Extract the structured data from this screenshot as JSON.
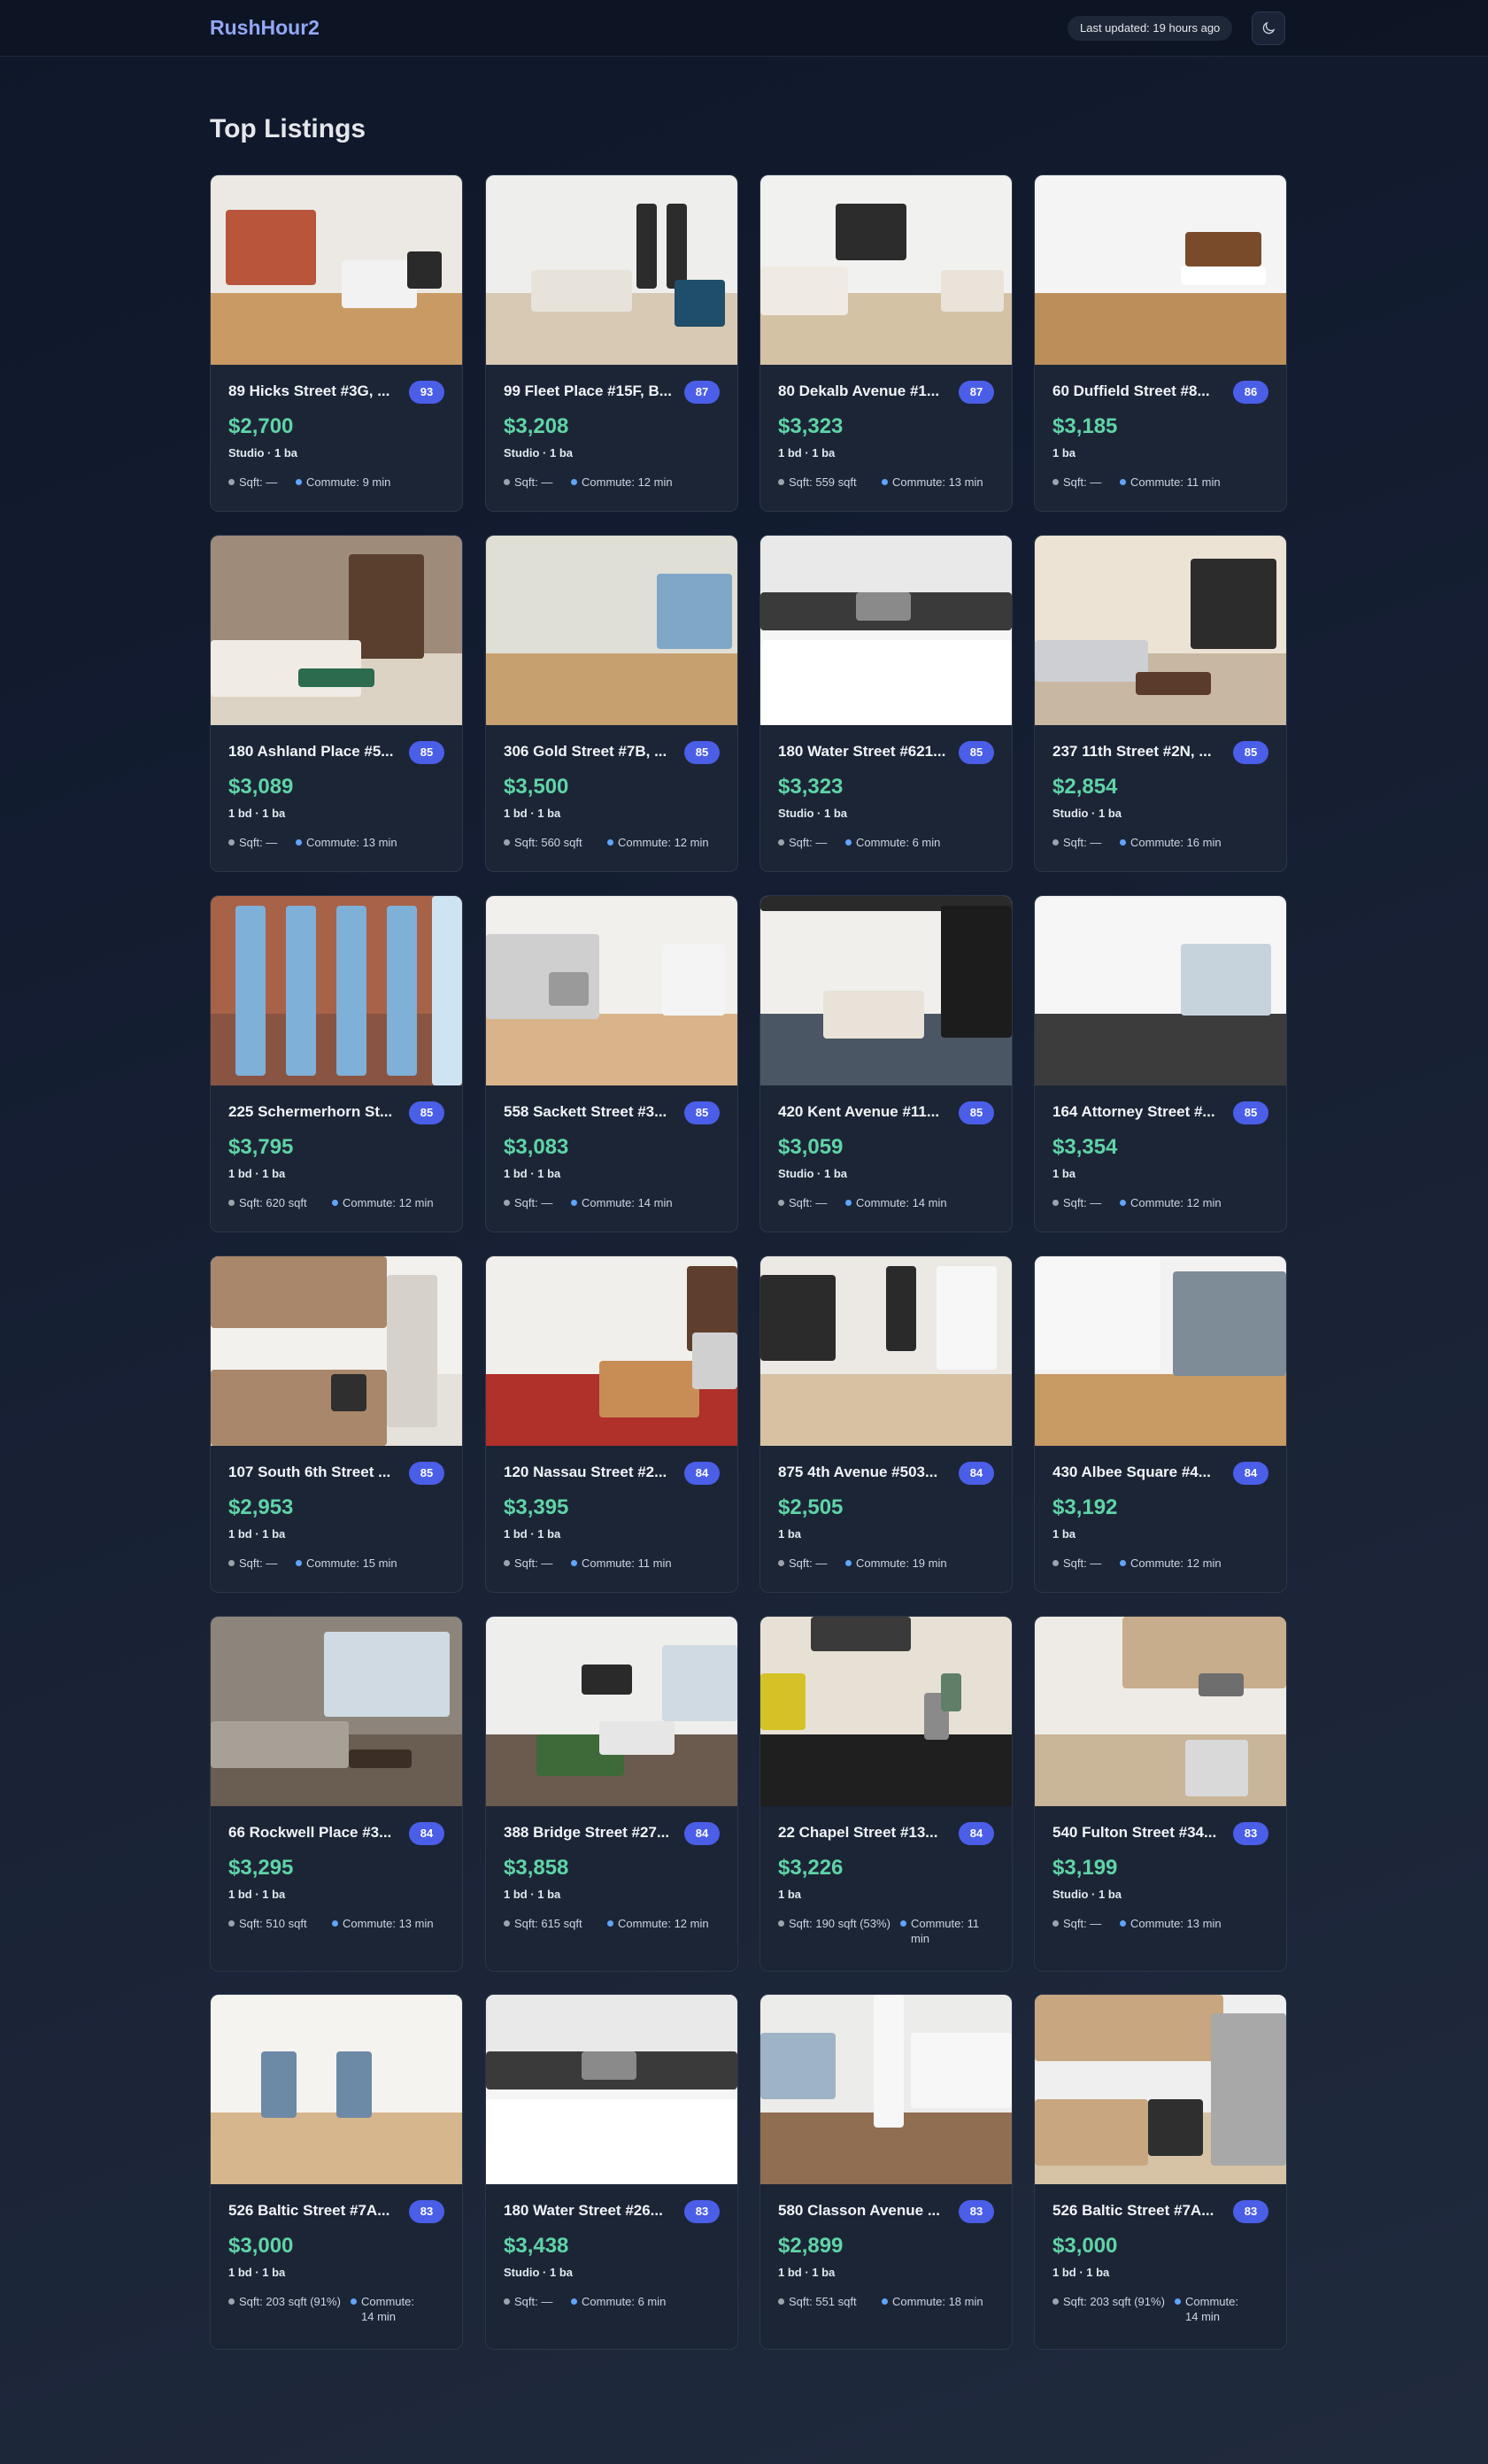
{
  "header": {
    "brand": "RushHour2",
    "last_updated": "Last updated: 19 hours ago",
    "theme_icon": "moon-icon"
  },
  "page": {
    "title": "Top Listings"
  },
  "listings": [
    {
      "title": "89 Hicks Street #3G, ...",
      "score": "93",
      "price": "$2,700",
      "beds": "Studio · 1 ba",
      "sqft": "Sqft: —",
      "commute": "Commute: 9 min",
      "img": "kitchen-living"
    },
    {
      "title": "99 Fleet Place #15F, B...",
      "score": "87",
      "price": "$3,208",
      "beds": "Studio · 1 ba",
      "sqft": "Sqft: —",
      "commute": "Commute: 12 min",
      "img": "living-windows"
    },
    {
      "title": "80 Dekalb Avenue #1...",
      "score": "87",
      "price": "$3,323",
      "beds": "1 bd · 1 ba",
      "sqft": "Sqft: 559 sqft",
      "commute": "Commute: 13 min",
      "img": "living-bright"
    },
    {
      "title": "60 Duffield Street #8...",
      "score": "86",
      "price": "$3,185",
      "beds": "1 ba",
      "sqft": "Sqft: —",
      "commute": "Commute: 11 min",
      "img": "empty-room"
    },
    {
      "title": "180 Ashland Place #5...",
      "score": "85",
      "price": "$3,089",
      "beds": "1 bd · 1 ba",
      "sqft": "Sqft: —",
      "commute": "Commute: 13 min",
      "img": "brick-living"
    },
    {
      "title": "306 Gold Street #7B, ...",
      "score": "85",
      "price": "$3,500",
      "beds": "1 bd · 1 ba",
      "sqft": "Sqft: 560 sqft",
      "commute": "Commute: 12 min",
      "img": "empty-wood"
    },
    {
      "title": "180 Water Street #621...",
      "score": "85",
      "price": "$3,323",
      "beds": "Studio · 1 ba",
      "sqft": "Sqft: —",
      "commute": "Commute: 6 min",
      "img": "white-kitchen"
    },
    {
      "title": "237 11th Street #2N, ...",
      "score": "85",
      "price": "$2,854",
      "beds": "Studio · 1 ba",
      "sqft": "Sqft: —",
      "commute": "Commute: 16 min",
      "img": "studio-living"
    },
    {
      "title": "225 Schermerhorn St...",
      "score": "85",
      "price": "$3,795",
      "beds": "1 bd · 1 ba",
      "sqft": "Sqft: 620 sqft",
      "commute": "Commute: 12 min",
      "img": "building"
    },
    {
      "title": "558 Sackett Street #3...",
      "score": "85",
      "price": "$3,083",
      "beds": "1 bd · 1 ba",
      "sqft": "Sqft: —",
      "commute": "Commute: 14 min",
      "img": "kitchen-open"
    },
    {
      "title": "420 Kent Avenue #11...",
      "score": "85",
      "price": "$3,059",
      "beds": "Studio · 1 ba",
      "sqft": "Sqft: —",
      "commute": "Commute: 14 min",
      "img": "bedroom-dark"
    },
    {
      "title": "164 Attorney Street #...",
      "score": "85",
      "price": "$3,354",
      "beds": "1 ba",
      "sqft": "Sqft: —",
      "commute": "Commute: 12 min",
      "img": "empty-dark-floor"
    },
    {
      "title": "107 South 6th Street ...",
      "score": "85",
      "price": "$2,953",
      "beds": "1 bd · 1 ba",
      "sqft": "Sqft: —",
      "commute": "Commute: 15 min",
      "img": "wood-kitchen"
    },
    {
      "title": "120 Nassau Street #2...",
      "score": "84",
      "price": "$3,395",
      "beds": "1 bd · 1 ba",
      "sqft": "Sqft: —",
      "commute": "Commute: 11 min",
      "img": "open-living"
    },
    {
      "title": "875 4th Avenue #503...",
      "score": "84",
      "price": "$2,505",
      "beds": "1 ba",
      "sqft": "Sqft: —",
      "commute": "Commute: 19 min",
      "img": "empty-door"
    },
    {
      "title": "430 Albee Square #4...",
      "score": "84",
      "price": "$3,192",
      "beds": "1 ba",
      "sqft": "Sqft: —",
      "commute": "Commute: 12 min",
      "img": "corner-windows"
    },
    {
      "title": "66 Rockwell Place #3...",
      "score": "84",
      "price": "$3,295",
      "beds": "1 bd · 1 ba",
      "sqft": "Sqft: 510 sqft",
      "commute": "Commute: 13 min",
      "img": "living-view"
    },
    {
      "title": "388 Bridge Street #27...",
      "score": "84",
      "price": "$3,858",
      "beds": "1 bd · 1 ba",
      "sqft": "Sqft: 615 sqft",
      "commute": "Commute: 12 min",
      "img": "green-living"
    },
    {
      "title": "22 Chapel Street #13...",
      "score": "84",
      "price": "$3,226",
      "beds": "1 ba",
      "sqft": "Sqft: 190 sqft (53%)",
      "commute": "Commute: 11 min",
      "img": "dark-counter",
      "wrap": true
    },
    {
      "title": "540 Fulton Street #34...",
      "score": "83",
      "price": "$3,199",
      "beds": "Studio · 1 ba",
      "sqft": "Sqft: —",
      "commute": "Commute: 13 min",
      "img": "beige-kitchen"
    },
    {
      "title": "526 Baltic Street #7A...",
      "score": "83",
      "price": "$3,000",
      "beds": "1 bd · 1 ba",
      "sqft": "Sqft: 203 sqft (91%)",
      "commute": "Commute: 14 min",
      "img": "white-room",
      "wrap": true
    },
    {
      "title": "180 Water Street #26...",
      "score": "83",
      "price": "$3,438",
      "beds": "Studio · 1 ba",
      "sqft": "Sqft: —",
      "commute": "Commute: 6 min",
      "img": "white-kitchen"
    },
    {
      "title": "580 Classon Avenue ...",
      "score": "83",
      "price": "$2,899",
      "beds": "1 bd · 1 ba",
      "sqft": "Sqft: 551 sqft",
      "commute": "Commute: 18 min",
      "img": "closet-room"
    },
    {
      "title": "526 Baltic Street #7A...",
      "score": "83",
      "price": "$3,000",
      "beds": "1 bd · 1 ba",
      "sqft": "Sqft: 203 sqft (91%)",
      "commute": "Commute: 14 min",
      "img": "steel-kitchen",
      "wrap": true
    }
  ]
}
